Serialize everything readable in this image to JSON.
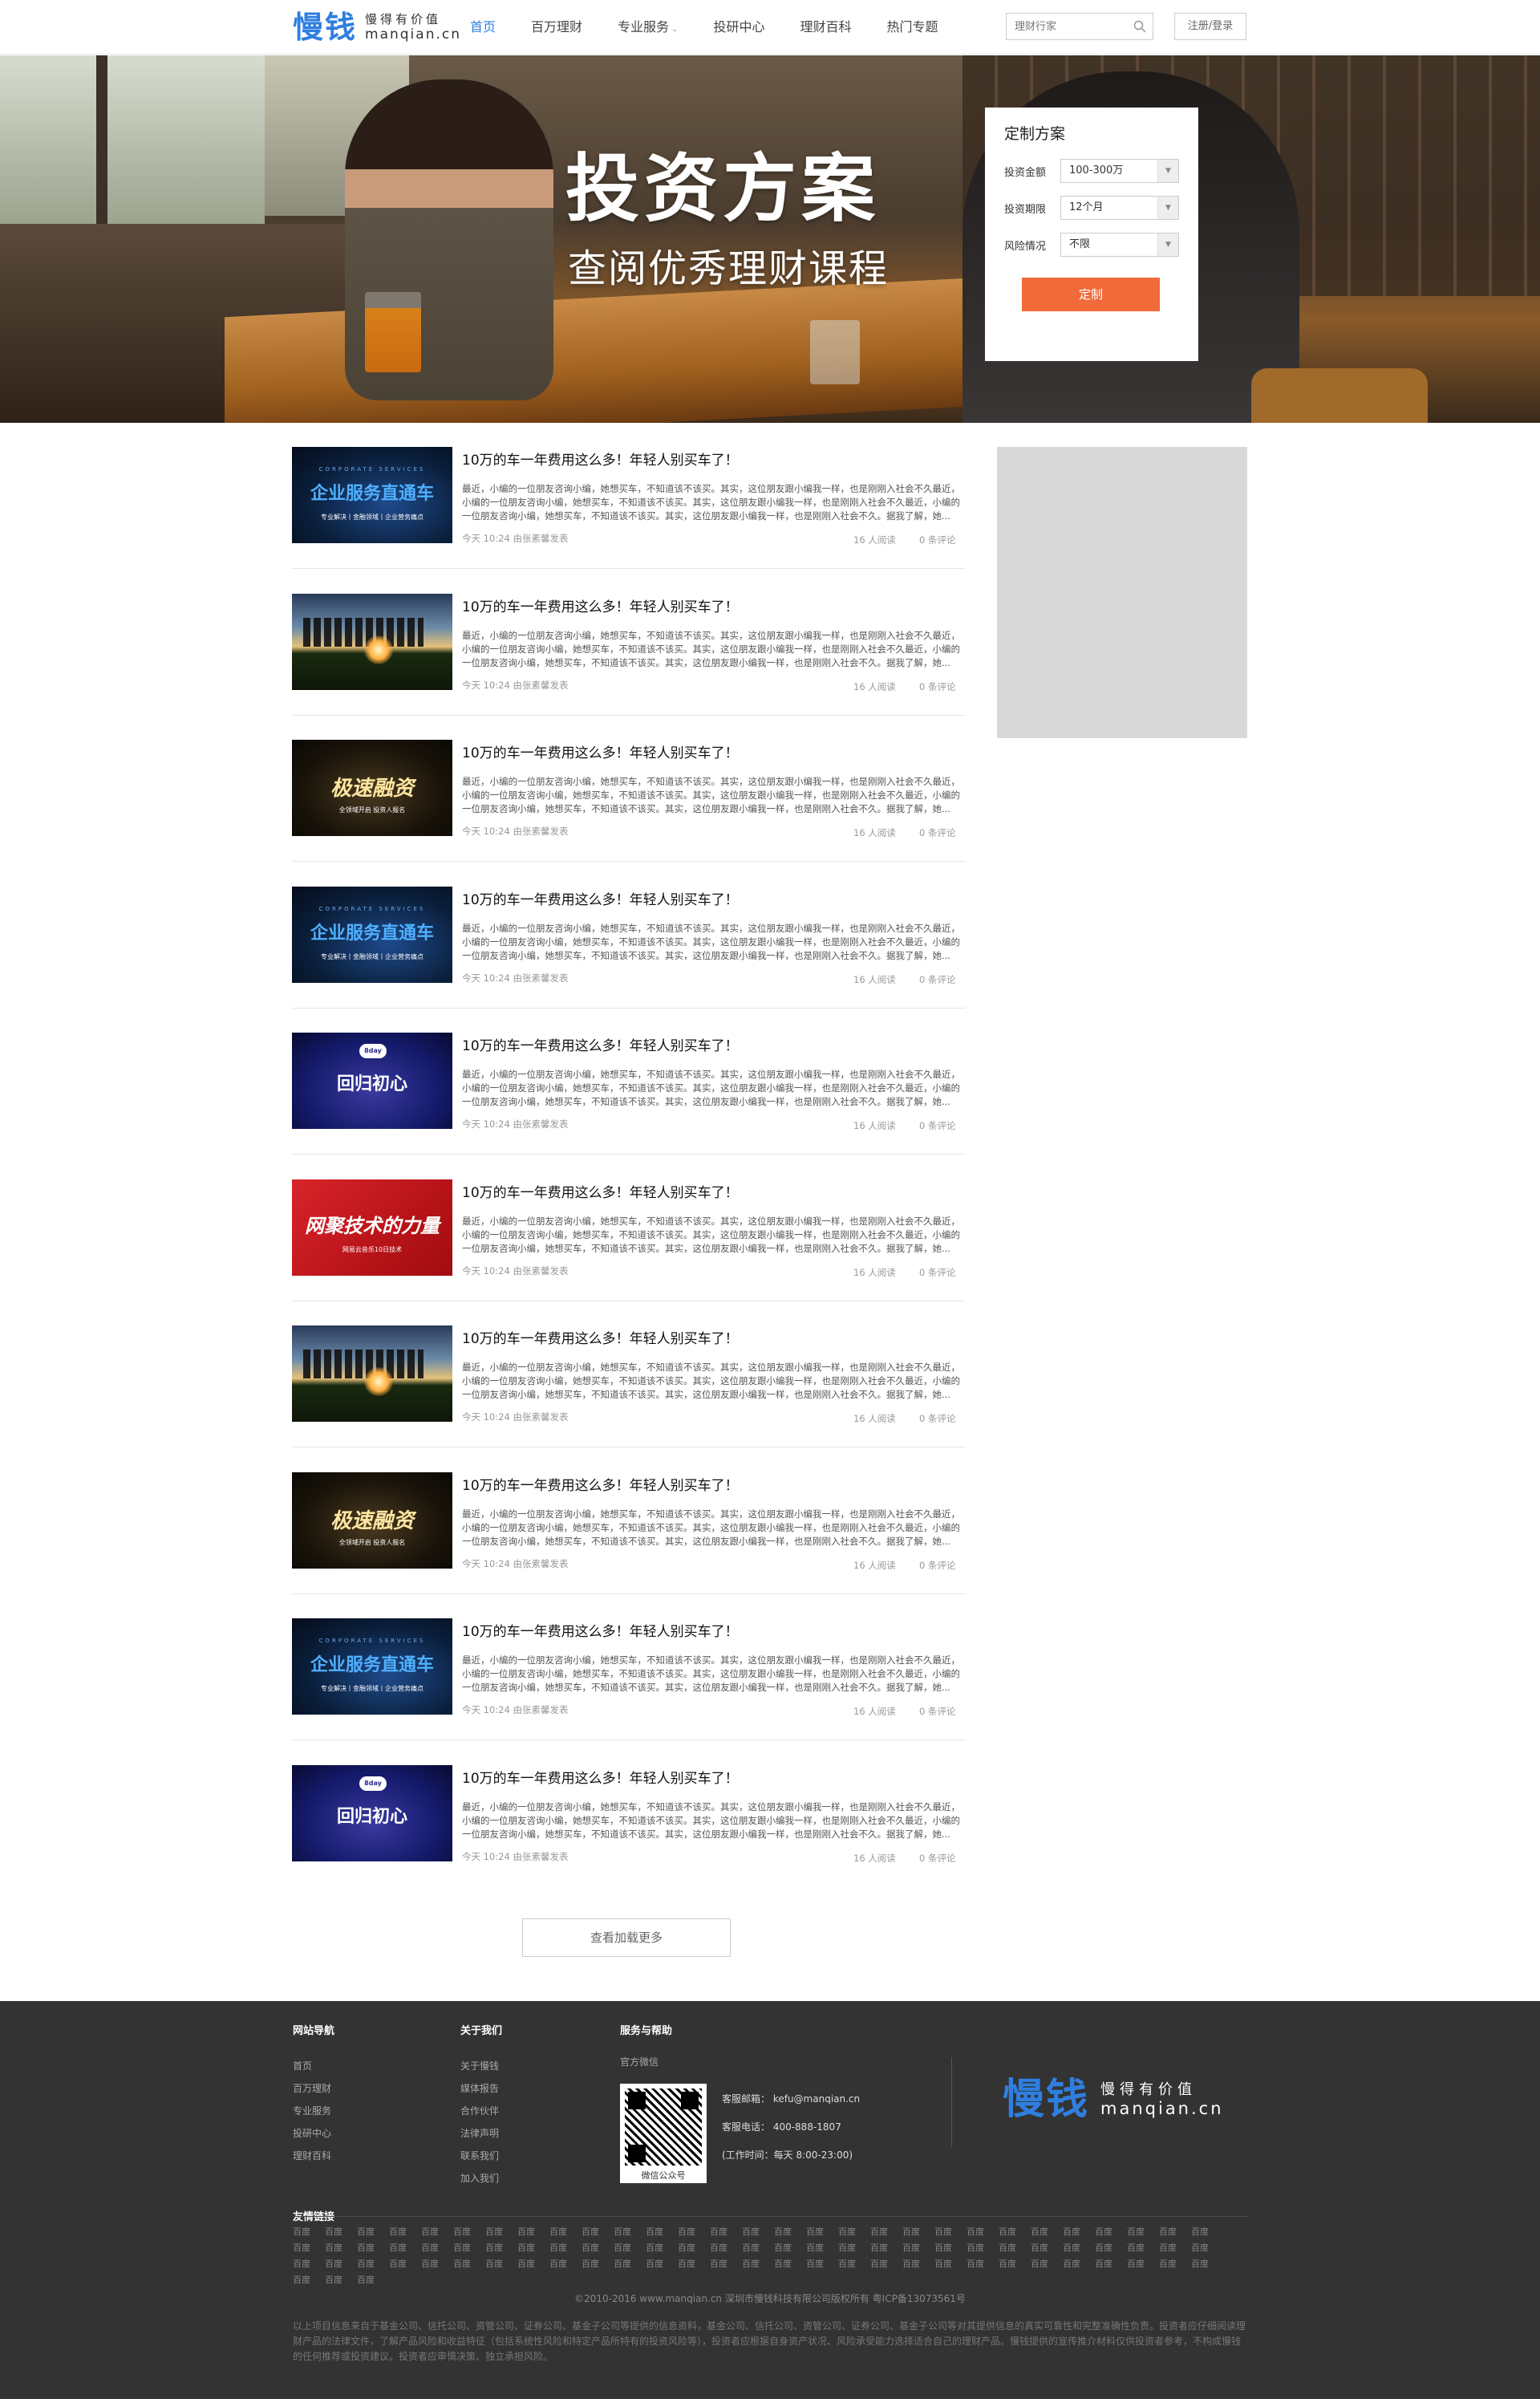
{
  "header": {
    "logo_mark": "慢钱",
    "logo_slogan": "慢得有价值",
    "logo_domain": "manqian.cn",
    "nav": [
      "首页",
      "百万理财",
      "专业服务",
      "投研中心",
      "理财百科",
      "热门专题"
    ],
    "active_nav": "首页",
    "search_placeholder": "理财行家",
    "login_label": "注册/登录"
  },
  "banner": {
    "title": "投资方案",
    "subtitle": "查阅优秀理财课程"
  },
  "plan": {
    "title": "定制方案",
    "fields": [
      {
        "label": "投资金额",
        "value": "100-300万"
      },
      {
        "label": "投资期限",
        "value": "12个月"
      },
      {
        "label": "风险情况",
        "value": "不限"
      }
    ],
    "button": "定制"
  },
  "articles": [
    {
      "thumb": "corp",
      "thumb_text": "企业服务直通车",
      "thumb_top": "CORPORATE SERVICES",
      "thumb_foot": "专业解决丨金融领域丨企业营务痛点"
    },
    {
      "thumb": "sunset",
      "thumb_text": "",
      "thumb_top": "",
      "thumb_foot": ""
    },
    {
      "thumb": "speed",
      "thumb_text": "极速融资",
      "thumb_top": "",
      "thumb_foot": "全领域开启 投资人报名"
    },
    {
      "thumb": "corp",
      "thumb_text": "企业服务直通车",
      "thumb_top": "CORPORATE SERVICES",
      "thumb_foot": "专业解决丨金融领域丨企业营务痛点"
    },
    {
      "thumb": "return",
      "thumb_text": "回归初心",
      "thumb_top": "",
      "thumb_foot": "",
      "thumb_badge": "8day"
    },
    {
      "thumb": "red",
      "thumb_text": "网聚技术的力量",
      "thumb_top": "",
      "thumb_foot": "网易云音乐10日技术"
    },
    {
      "thumb": "sunset",
      "thumb_text": "",
      "thumb_top": "",
      "thumb_foot": ""
    },
    {
      "thumb": "speed",
      "thumb_text": "极速融资",
      "thumb_top": "",
      "thumb_foot": "全领域开启 投资人报名"
    },
    {
      "thumb": "corp",
      "thumb_text": "企业服务直通车",
      "thumb_top": "CORPORATE SERVICES",
      "thumb_foot": "专业解决丨金融领域丨企业营务痛点"
    },
    {
      "thumb": "return",
      "thumb_text": "回归初心",
      "thumb_top": "",
      "thumb_foot": "",
      "thumb_badge": "8day"
    }
  ],
  "article_common": {
    "title": "10万的车一年费用这么多！年轻人别买车了！",
    "desc": "最近，小编的一位朋友咨询小编，她想买车，不知道该不该买。其实，这位朋友跟小编我一样，也是刚刚入社会不久最近，小编的一位朋友咨询小编，她想买车，不知道该不该买。其实，这位朋友跟小编我一样，也是刚刚入社会不久最近，小编的一位朋友咨询小编，她想买车，不知道该不该买。其实，这位朋友跟小编我一样，也是刚刚入社会不久。据我了解，她...",
    "meta": "今天 10:24 由张素馨发表",
    "reads": "16 人阅读",
    "comments": "0 条评论"
  },
  "more_label": "查看加载更多",
  "footer": {
    "nav_title": "网站导航",
    "nav_links": [
      "首页",
      "百万理财",
      "专业服务",
      "投研中心",
      "理财百科"
    ],
    "about_title": "关于我们",
    "about_links": [
      "关于慢钱",
      "媒体报告",
      "合作伙伴",
      "法律声明",
      "联系我们",
      "加入我们"
    ],
    "service_title": "服务与帮助",
    "official_wechat": "官方微信",
    "qr_label": "微信公众号",
    "email": "客服邮箱：  kefu@manqian.cn",
    "phone": "客服电话：  400-888-1807",
    "hours": "(工作时间：每天  8:00-23:00)",
    "friend_title": "友情链接",
    "friend_link": "百度",
    "copyright": "©2010-2016 www.manqian.cn 深圳市慢钱科技有限公司版权所有    粤ICP备13073561号",
    "disclaimer": "以上项目信息来自于基金公司、信托公司、资管公司、证券公司、基金子公司等提供的信息资料，基金公司、信托公司、资管公司、证券公司、基金子公司等对其提供信息的真实可靠性和完整准确性负责。投资者应仔细阅读理财产品的法律文件，了解产品风险和收益特征（包括系统性风险和特定产品所特有的投资风险等），投资者应根据自身资产状况、风险承受能力选择适合自己的理财产品。慢钱提供的宣传推介材料仅供投资者参考，不构成慢钱的任何推荐或投资建议。投资者应审慎决策、独立承担风险。"
  }
}
